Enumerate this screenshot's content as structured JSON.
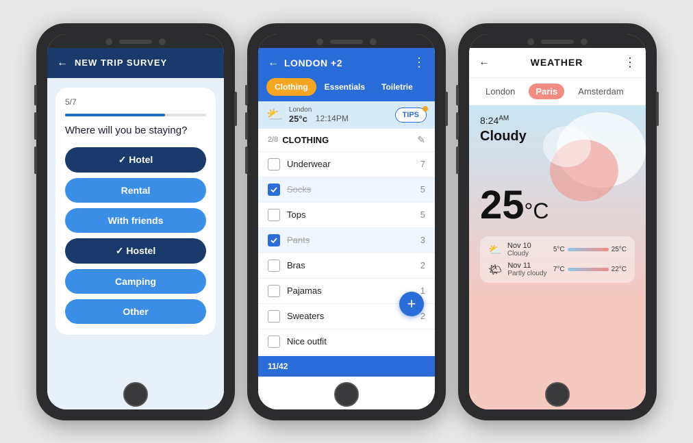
{
  "phone1": {
    "header": {
      "back_label": "←",
      "title": "NEW TRIP SURVEY"
    },
    "progress": {
      "label": "5/7",
      "fill_percent": "71%"
    },
    "question": "Where will you be staying?",
    "options": [
      {
        "label": "✓ Hotel",
        "selected": true
      },
      {
        "label": "Rental",
        "selected": false
      },
      {
        "label": "With friends",
        "selected": false
      },
      {
        "label": "✓ Hostel",
        "selected": true
      },
      {
        "label": "Camping",
        "selected": false
      },
      {
        "label": "Other",
        "selected": false
      }
    ]
  },
  "phone2": {
    "header": {
      "back_label": "←",
      "title": "LONDON +2",
      "dots": "⋮"
    },
    "tabs": [
      {
        "label": "Clothing",
        "active": true
      },
      {
        "label": "Essentials",
        "active": false
      },
      {
        "label": "Toiletrie",
        "active": false
      }
    ],
    "weather": {
      "icon": "⛅",
      "city": "London",
      "temp": "25°c",
      "time": "12:14PM",
      "tips_label": "TIPS"
    },
    "section": {
      "count": "2/8",
      "title": "CLOTHING",
      "edit_icon": "✎"
    },
    "items": [
      {
        "name": "Underwear",
        "count": "7",
        "checked": false,
        "done": false
      },
      {
        "name": "Socks",
        "count": "5",
        "checked": true,
        "done": true
      },
      {
        "name": "Tops",
        "count": "5",
        "checked": false,
        "done": false
      },
      {
        "name": "Pants",
        "count": "3",
        "checked": true,
        "done": true
      },
      {
        "name": "Bras",
        "count": "2",
        "checked": false,
        "done": false
      },
      {
        "name": "Pajamas",
        "count": "1",
        "checked": false,
        "done": false
      },
      {
        "name": "Sweaters",
        "count": "2",
        "checked": false,
        "done": false
      },
      {
        "name": "Nice outfit",
        "count": "",
        "checked": false,
        "done": false
      }
    ],
    "footer": {
      "count": "11/42"
    },
    "add_label": "+"
  },
  "phone3": {
    "header": {
      "back_label": "←",
      "title": "WEATHER",
      "dots": "⋮"
    },
    "city_tabs": [
      {
        "label": "London",
        "active": false
      },
      {
        "label": "Paris",
        "active": true
      },
      {
        "label": "Amsterdam",
        "active": false
      }
    ],
    "current": {
      "time": "8:24",
      "am_pm": "AM",
      "condition": "Cloudy",
      "temp": "25",
      "unit": "°C"
    },
    "forecast": [
      {
        "icon": "⛅",
        "date": "Nov 10",
        "condition": "Cloudy",
        "temp_low": "5°C",
        "temp_high": "25°C"
      },
      {
        "icon": "🌤",
        "date": "Nov 11",
        "condition": "Partly cloudy",
        "temp_low": "7°C",
        "temp_high": "22°C"
      }
    ]
  }
}
